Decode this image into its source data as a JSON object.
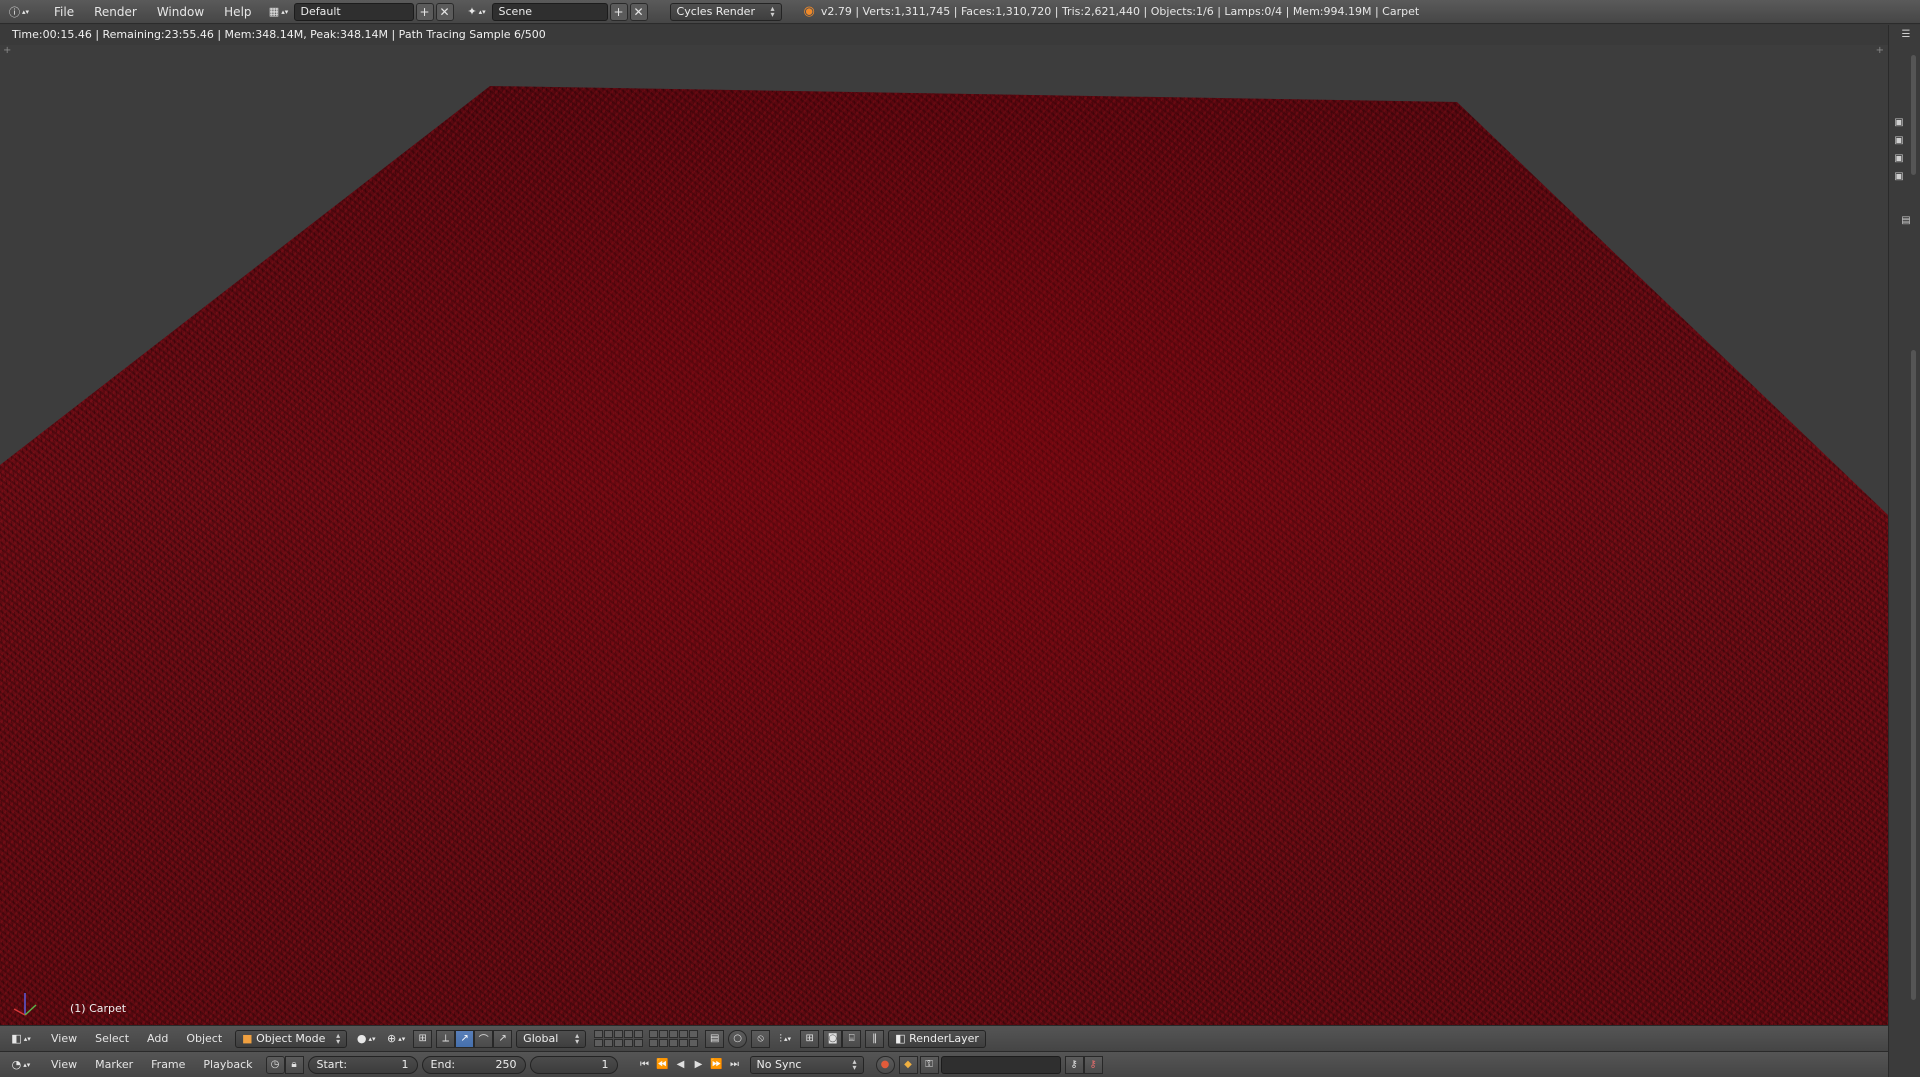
{
  "top_bar": {
    "menus": [
      "File",
      "Render",
      "Window",
      "Help"
    ],
    "layout_name": "Default",
    "scene_name": "Scene",
    "render_engine": "Cycles Render",
    "stats": "v2.79 | Verts:1,311,745 | Faces:1,310,720 | Tris:2,621,440 | Objects:1/6 | Lamps:0/4 | Mem:994.19M | Carpet"
  },
  "status_line": "Time:00:15.46 | Remaining:23:55.46 | Mem:348.14M, Peak:348.14M | Path Tracing Sample 6/500",
  "viewport": {
    "object_label": "(1) Carpet",
    "colors": {
      "carpet": "#5e0a11",
      "background": "#3d3d3d"
    }
  },
  "view3d_header": {
    "menus": [
      "View",
      "Select",
      "Add",
      "Object"
    ],
    "mode": "Object Mode",
    "orientation": "Global",
    "render_layer": "RenderLayer"
  },
  "timeline_header": {
    "menus": [
      "View",
      "Marker",
      "Frame",
      "Playback"
    ],
    "start_label": "Start:",
    "start_value": "1",
    "end_label": "End:",
    "end_value": "250",
    "current_frame": "1",
    "sync": "No Sync"
  }
}
